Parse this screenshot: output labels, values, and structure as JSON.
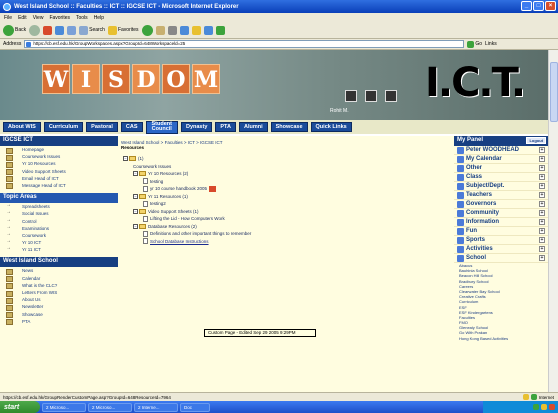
{
  "window": {
    "title": "West Island School :: Faculties :: ICT :: IGCSE ICT - Microsoft Internet Explorer"
  },
  "menu": [
    "File",
    "Edit",
    "View",
    "Favorites",
    "Tools",
    "Help"
  ],
  "toolbar": {
    "back": "Back",
    "search": "Search",
    "favorites": "Favorites"
  },
  "address": {
    "label": "Address",
    "url": "https://cb.esf.edu.hk/GroupWorkspaces.aspx?GroupId=648Workspaceld=25",
    "go": "Go",
    "links": "Links"
  },
  "banner": {
    "letters": [
      "W",
      "I",
      "S",
      "D",
      "O",
      "M"
    ],
    "logo": "I.C.T.",
    "person": "Rohit M."
  },
  "nav": [
    "About WIS",
    "Curriculum",
    "Pastoral",
    "CAS",
    "Student",
    "Council",
    "Dynasty",
    "PTA",
    "Alumni",
    "Showcase",
    "Quick Links"
  ],
  "left": {
    "title": "IGCSE ICT",
    "items": [
      "Homepage",
      "Coursework Issues",
      "Yr 10 Resources",
      "Video Support Sheets",
      "Email Head of ICT",
      "Message Head of ICT"
    ],
    "topic_title": "Topic Areas",
    "topics": [
      "Spreadsheets",
      "Social Issues",
      "Control",
      "Examinations",
      "Coursework",
      "Yr 10 ICT",
      "Yr 11 ICT"
    ],
    "wis_title": "West Island School",
    "wis_items": [
      "News",
      "Calendar",
      "What is the CLC?",
      "Letters From WIS",
      "About Us",
      "Newsletter",
      "Showcase",
      "PTA"
    ]
  },
  "center": {
    "crumb": "West Island School > Faculties > ICT > IGCSE ICT",
    "subtitle": "Resources",
    "tree": [
      {
        "depth": 0,
        "kind": "folder",
        "text": "(1)"
      },
      {
        "depth": 1,
        "kind": "text",
        "text": "Coursework Issues"
      },
      {
        "depth": 1,
        "kind": "folder",
        "text": "Yr 10 Resources (2)"
      },
      {
        "depth": 2,
        "kind": "doc",
        "text": "testing"
      },
      {
        "depth": 2,
        "kind": "doc",
        "text": "yr 10 course handbook 2005",
        "new": true
      },
      {
        "depth": 1,
        "kind": "folder",
        "text": "Yr 11 Resources (1)"
      },
      {
        "depth": 2,
        "kind": "doc",
        "text": "testing2"
      },
      {
        "depth": 1,
        "kind": "folder",
        "text": "Video Support Sheets (1)"
      },
      {
        "depth": 2,
        "kind": "doc",
        "text": "Lifting the Lid - How Computers Work"
      },
      {
        "depth": 1,
        "kind": "folder",
        "text": "Database Resources (2)"
      },
      {
        "depth": 2,
        "kind": "doc",
        "text": "Definitions and other important things to remember"
      },
      {
        "depth": 2,
        "kind": "link",
        "text": "School Database Instructions"
      }
    ],
    "tooltip": "Custom Page - Edited Sep 29 2005 9:29PM"
  },
  "panel": {
    "title": "My Panel",
    "logout": "Logout",
    "items": [
      "Peter WOODHEAD",
      "My Calendar",
      "Other",
      "Class",
      "Subject/Dept.",
      "Teachers",
      "Governors",
      "Community",
      "Information",
      "Fun",
      "Sports",
      "Activities",
      "School"
    ],
    "schools": [
      "Abacus",
      "Bauhinia School",
      "Beacon Hill School",
      "Bradbury School",
      "Careers",
      "Clearwater Bay School",
      "Creative Crafts",
      "Curriculum",
      "ESF",
      "ESF Kindergartens",
      "Faculties",
      "FMO",
      "Glenealy School",
      "Go With Prakan",
      "Hong Kong Based Activities"
    ]
  },
  "status": {
    "url": "https://cb.esf.edu.hk/GroupRenderCustomPage.asp?GroupId=648ResourceId=7964",
    "zone": "Internet"
  },
  "taskbar": {
    "start": "start",
    "tasks": [
      "2 Microso...",
      "2 Microso...",
      "2 Interne...",
      "Doc"
    ]
  }
}
